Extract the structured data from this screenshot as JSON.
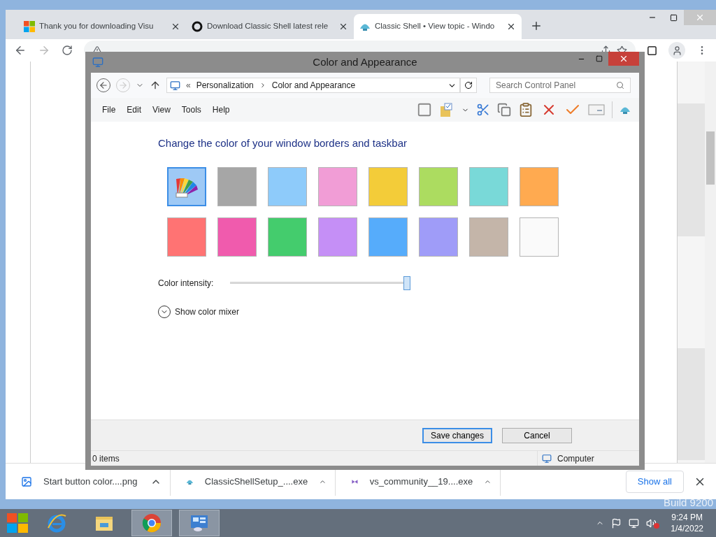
{
  "browser": {
    "tabs": [
      {
        "title": "Thank you for downloading Visu",
        "kind": "ms",
        "selected": false
      },
      {
        "title": "Download Classic Shell latest rele",
        "kind": "ring",
        "selected": false
      },
      {
        "title": "Classic Shell • View topic - Windo",
        "kind": "shell",
        "selected": true
      }
    ]
  },
  "dialog": {
    "title": "Color and Appearance",
    "breadcrumb_overflow": "«",
    "breadcrumb": [
      "Personalization",
      "Color and Appearance"
    ],
    "search_placeholder": "Search Control Panel",
    "menu": [
      "File",
      "Edit",
      "View",
      "Tools",
      "Help"
    ],
    "heading": "Change the color of your window borders and taskbar",
    "swatches": [
      {
        "kind": "automatic",
        "color": "#9ec9f5",
        "selected": true
      },
      {
        "kind": "color",
        "color": "#a6a6a6",
        "selected": false
      },
      {
        "kind": "color",
        "color": "#8ecbfa",
        "selected": false
      },
      {
        "kind": "color",
        "color": "#f19dd6",
        "selected": false
      },
      {
        "kind": "color",
        "color": "#f3cc39",
        "selected": false
      },
      {
        "kind": "color",
        "color": "#acdc60",
        "selected": false
      },
      {
        "kind": "color",
        "color": "#79d9d8",
        "selected": false
      },
      {
        "kind": "color",
        "color": "#ffaa50",
        "selected": false
      },
      {
        "kind": "color",
        "color": "#ff7373",
        "selected": false
      },
      {
        "kind": "color",
        "color": "#f05bad",
        "selected": false
      },
      {
        "kind": "color",
        "color": "#44cc6d",
        "selected": false
      },
      {
        "kind": "color",
        "color": "#c58ff6",
        "selected": false
      },
      {
        "kind": "color",
        "color": "#56acfb",
        "selected": false
      },
      {
        "kind": "color",
        "color": "#9f9cf8",
        "selected": false
      },
      {
        "kind": "color",
        "color": "#c4b5a9",
        "selected": false
      },
      {
        "kind": "color",
        "color": "#fafafa",
        "selected": false
      }
    ],
    "intensity": {
      "label": "Color intensity:",
      "level": 1
    },
    "mixer": {
      "label": "Show color mixer",
      "expanded": false
    },
    "buttons": [
      {
        "label": "Save changes",
        "default": true
      },
      {
        "label": "Cancel",
        "default": false
      }
    ],
    "status": {
      "items": "0 items",
      "zone": "Computer"
    }
  },
  "downloads": {
    "files": [
      {
        "name": "Start button color....png",
        "kind": "image"
      },
      {
        "name": "ClassicShellSetup_....exe",
        "kind": "shell"
      },
      {
        "name": "vs_community__19....exe",
        "kind": "vs"
      }
    ],
    "show_all": "Show all"
  },
  "desktop": {
    "watermark": "Build 9200"
  },
  "taskbar": {
    "apps": [
      {
        "kind": "ie",
        "active": false
      },
      {
        "kind": "explorer",
        "active": false
      },
      {
        "kind": "chrome",
        "active": true
      },
      {
        "kind": "control",
        "active": true
      }
    ],
    "clock": {
      "time": "9:24 PM",
      "date": "1/4/2022"
    }
  }
}
